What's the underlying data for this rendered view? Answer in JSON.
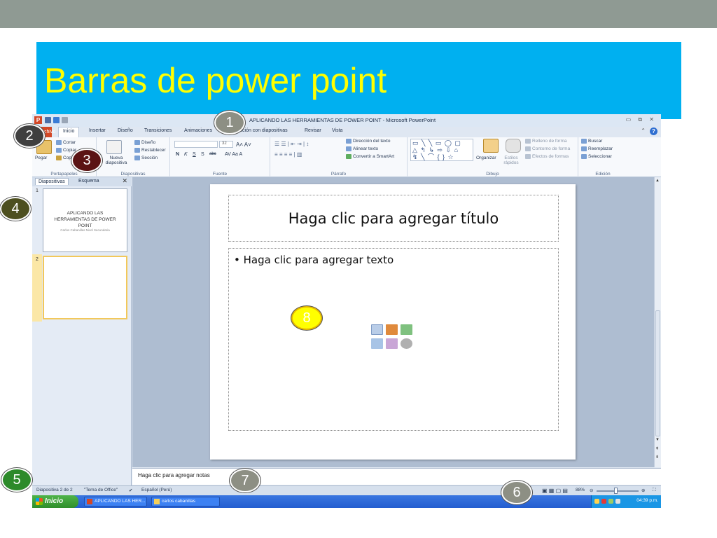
{
  "slide_title": "Barras de power point",
  "window": {
    "title": "APLICANDO LAS HERRAMIENTAS DE POWER POINT - Microsoft PowerPoint",
    "controls": "▭ ⧉ ✕"
  },
  "tabs": [
    {
      "label": "Archivo"
    },
    {
      "label": "Inicio"
    },
    {
      "label": "Insertar"
    },
    {
      "label": "Diseño"
    },
    {
      "label": "Transiciones"
    },
    {
      "label": "Animaciones"
    },
    {
      "label": "Presentación con diapositivas"
    },
    {
      "label": "Revisar"
    },
    {
      "label": "Vista"
    }
  ],
  "ribbon": {
    "portapapeles": {
      "paste": "Pegar",
      "cut": "Cortar",
      "copy": "Copiar",
      "format": "Copiar formato",
      "label": "Portapapeles"
    },
    "diapositivas": {
      "new": "Nueva diapositiva",
      "design": "Diseño",
      "reset": "Restablecer",
      "section": "Sección",
      "label": "Diapositivas"
    },
    "fuente": {
      "size": "32",
      "bold": "N",
      "italic": "K",
      "underline": "S",
      "shadow": "S",
      "strike": "abc",
      "label": "Fuente"
    },
    "parrafo": {
      "direction": "Dirección del texto",
      "align": "Alinear texto",
      "smartart": "Convertir a SmartArt",
      "label": "Párrafo"
    },
    "dibujo": {
      "arrange": "Organizar",
      "styles": "Estilos rápidos",
      "fill": "Relleno de forma",
      "outline": "Contorno de forma",
      "effects": "Efectos de formas",
      "label": "Dibujo"
    },
    "edicion": {
      "find": "Buscar",
      "replace": "Reemplazar",
      "select": "Seleccionar",
      "label": "Edición"
    }
  },
  "pane": {
    "tabs": [
      "Diapositivas",
      "Esquema"
    ],
    "slides": [
      {
        "num": "1",
        "title": "APLICANDO LAS HERRAMIENTAS DE POWER POINT",
        "subtitle": "Carlos Cabanillas  Nivel Secundaria"
      },
      {
        "num": "2",
        "title": "",
        "subtitle": ""
      }
    ]
  },
  "slide": {
    "title_placeholder": "Haga clic para agregar título",
    "body_placeholder": "Haga clic para agregar texto"
  },
  "notes_placeholder": "Haga clic para agregar notas",
  "status": {
    "slide": "Diapositiva 2 de 2",
    "theme": "\"Tema de Office\"",
    "language": "Español (Perú)",
    "zoom": "88%"
  },
  "taskbar": {
    "start": "Inicio",
    "tasks": [
      "APLICANDO LAS HER...",
      "carlos cabanillas"
    ],
    "time": "04:39 p.m."
  },
  "callouts": [
    "1",
    "2",
    "3",
    "4",
    "5",
    "6",
    "7",
    "8"
  ]
}
